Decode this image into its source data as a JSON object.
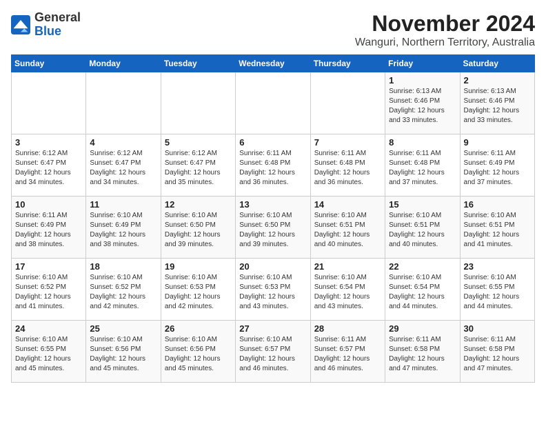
{
  "logo": {
    "general": "General",
    "blue": "Blue"
  },
  "title": "November 2024",
  "location": "Wanguri, Northern Territory, Australia",
  "days_header": [
    "Sunday",
    "Monday",
    "Tuesday",
    "Wednesday",
    "Thursday",
    "Friday",
    "Saturday"
  ],
  "weeks": [
    [
      {
        "day": "",
        "info": ""
      },
      {
        "day": "",
        "info": ""
      },
      {
        "day": "",
        "info": ""
      },
      {
        "day": "",
        "info": ""
      },
      {
        "day": "",
        "info": ""
      },
      {
        "day": "1",
        "info": "Sunrise: 6:13 AM\nSunset: 6:46 PM\nDaylight: 12 hours\nand 33 minutes."
      },
      {
        "day": "2",
        "info": "Sunrise: 6:13 AM\nSunset: 6:46 PM\nDaylight: 12 hours\nand 33 minutes."
      }
    ],
    [
      {
        "day": "3",
        "info": "Sunrise: 6:12 AM\nSunset: 6:47 PM\nDaylight: 12 hours\nand 34 minutes."
      },
      {
        "day": "4",
        "info": "Sunrise: 6:12 AM\nSunset: 6:47 PM\nDaylight: 12 hours\nand 34 minutes."
      },
      {
        "day": "5",
        "info": "Sunrise: 6:12 AM\nSunset: 6:47 PM\nDaylight: 12 hours\nand 35 minutes."
      },
      {
        "day": "6",
        "info": "Sunrise: 6:11 AM\nSunset: 6:48 PM\nDaylight: 12 hours\nand 36 minutes."
      },
      {
        "day": "7",
        "info": "Sunrise: 6:11 AM\nSunset: 6:48 PM\nDaylight: 12 hours\nand 36 minutes."
      },
      {
        "day": "8",
        "info": "Sunrise: 6:11 AM\nSunset: 6:48 PM\nDaylight: 12 hours\nand 37 minutes."
      },
      {
        "day": "9",
        "info": "Sunrise: 6:11 AM\nSunset: 6:49 PM\nDaylight: 12 hours\nand 37 minutes."
      }
    ],
    [
      {
        "day": "10",
        "info": "Sunrise: 6:11 AM\nSunset: 6:49 PM\nDaylight: 12 hours\nand 38 minutes."
      },
      {
        "day": "11",
        "info": "Sunrise: 6:10 AM\nSunset: 6:49 PM\nDaylight: 12 hours\nand 38 minutes."
      },
      {
        "day": "12",
        "info": "Sunrise: 6:10 AM\nSunset: 6:50 PM\nDaylight: 12 hours\nand 39 minutes."
      },
      {
        "day": "13",
        "info": "Sunrise: 6:10 AM\nSunset: 6:50 PM\nDaylight: 12 hours\nand 39 minutes."
      },
      {
        "day": "14",
        "info": "Sunrise: 6:10 AM\nSunset: 6:51 PM\nDaylight: 12 hours\nand 40 minutes."
      },
      {
        "day": "15",
        "info": "Sunrise: 6:10 AM\nSunset: 6:51 PM\nDaylight: 12 hours\nand 40 minutes."
      },
      {
        "day": "16",
        "info": "Sunrise: 6:10 AM\nSunset: 6:51 PM\nDaylight: 12 hours\nand 41 minutes."
      }
    ],
    [
      {
        "day": "17",
        "info": "Sunrise: 6:10 AM\nSunset: 6:52 PM\nDaylight: 12 hours\nand 41 minutes."
      },
      {
        "day": "18",
        "info": "Sunrise: 6:10 AM\nSunset: 6:52 PM\nDaylight: 12 hours\nand 42 minutes."
      },
      {
        "day": "19",
        "info": "Sunrise: 6:10 AM\nSunset: 6:53 PM\nDaylight: 12 hours\nand 42 minutes."
      },
      {
        "day": "20",
        "info": "Sunrise: 6:10 AM\nSunset: 6:53 PM\nDaylight: 12 hours\nand 43 minutes."
      },
      {
        "day": "21",
        "info": "Sunrise: 6:10 AM\nSunset: 6:54 PM\nDaylight: 12 hours\nand 43 minutes."
      },
      {
        "day": "22",
        "info": "Sunrise: 6:10 AM\nSunset: 6:54 PM\nDaylight: 12 hours\nand 44 minutes."
      },
      {
        "day": "23",
        "info": "Sunrise: 6:10 AM\nSunset: 6:55 PM\nDaylight: 12 hours\nand 44 minutes."
      }
    ],
    [
      {
        "day": "24",
        "info": "Sunrise: 6:10 AM\nSunset: 6:55 PM\nDaylight: 12 hours\nand 45 minutes."
      },
      {
        "day": "25",
        "info": "Sunrise: 6:10 AM\nSunset: 6:56 PM\nDaylight: 12 hours\nand 45 minutes."
      },
      {
        "day": "26",
        "info": "Sunrise: 6:10 AM\nSunset: 6:56 PM\nDaylight: 12 hours\nand 45 minutes."
      },
      {
        "day": "27",
        "info": "Sunrise: 6:10 AM\nSunset: 6:57 PM\nDaylight: 12 hours\nand 46 minutes."
      },
      {
        "day": "28",
        "info": "Sunrise: 6:11 AM\nSunset: 6:57 PM\nDaylight: 12 hours\nand 46 minutes."
      },
      {
        "day": "29",
        "info": "Sunrise: 6:11 AM\nSunset: 6:58 PM\nDaylight: 12 hours\nand 47 minutes."
      },
      {
        "day": "30",
        "info": "Sunrise: 6:11 AM\nSunset: 6:58 PM\nDaylight: 12 hours\nand 47 minutes."
      }
    ]
  ]
}
